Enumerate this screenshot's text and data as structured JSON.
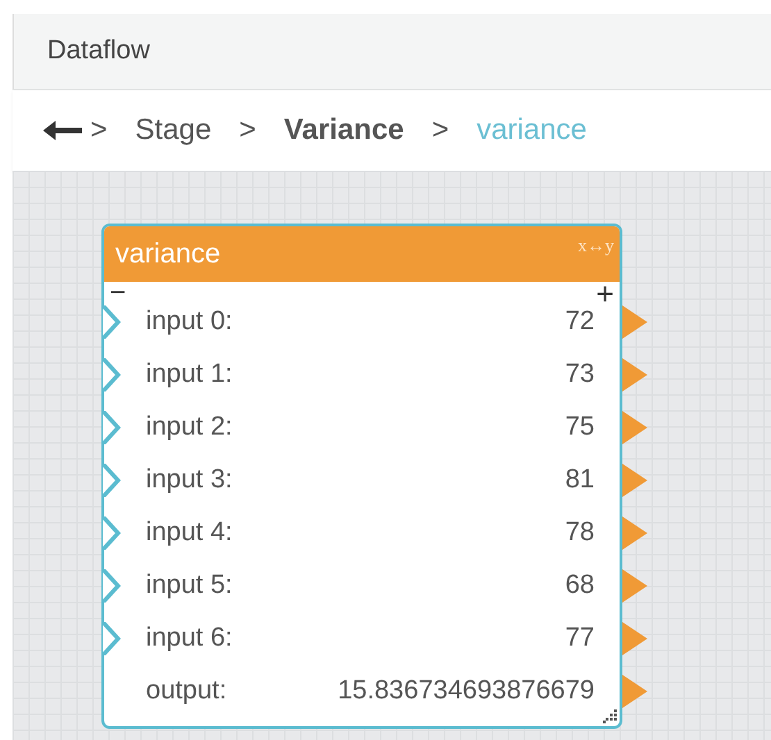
{
  "panel": {
    "title": "Dataflow"
  },
  "breadcrumb": [
    {
      "label": "Stage",
      "kind": "plain"
    },
    {
      "label": "Variance",
      "kind": "bold"
    },
    {
      "label": "variance",
      "kind": "current"
    }
  ],
  "separator": ">",
  "node": {
    "title": "variance",
    "type_label": "x↔y",
    "collapse": "−",
    "expand": "+",
    "rows": [
      {
        "kind": "input",
        "label": "input 0:",
        "value": "72"
      },
      {
        "kind": "input",
        "label": "input 1:",
        "value": "73"
      },
      {
        "kind": "input",
        "label": "input 2:",
        "value": "75"
      },
      {
        "kind": "input",
        "label": "input 3:",
        "value": "81"
      },
      {
        "kind": "input",
        "label": "input 4:",
        "value": "78"
      },
      {
        "kind": "input",
        "label": "input 5:",
        "value": "68"
      },
      {
        "kind": "input",
        "label": "input 6:",
        "value": "77"
      },
      {
        "kind": "output",
        "label": "output:",
        "value": "15.836734693876679"
      }
    ]
  }
}
